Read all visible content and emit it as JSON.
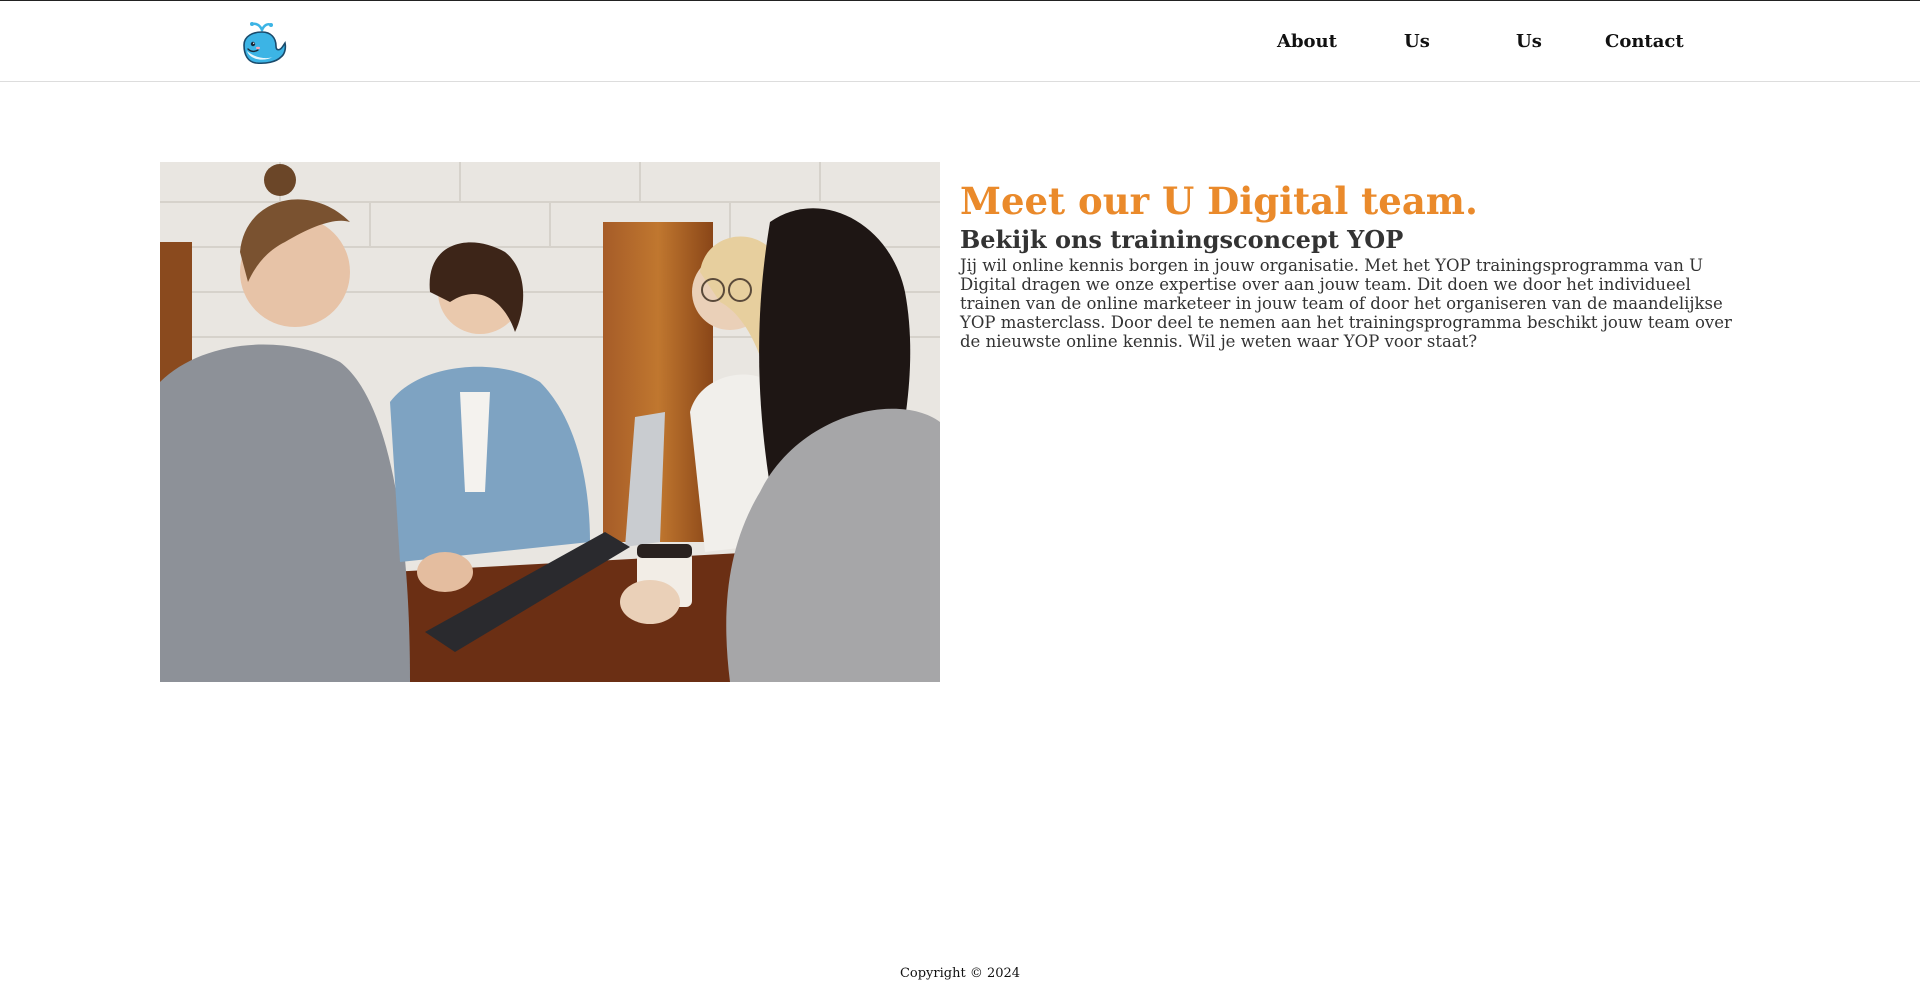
{
  "header": {
    "logo_name": "whale-logo",
    "nav": [
      {
        "label": "About"
      },
      {
        "label": "Us"
      },
      {
        "label": "Us"
      },
      {
        "label": "Contact"
      }
    ]
  },
  "main": {
    "image_name": "team-photo",
    "title": "Meet our U Digital team.",
    "subtitle": "Bekijk ons trainingsconcept YOP",
    "body": "Jij wil online kennis borgen in jouw organisatie. Met het YOP trainingsprogramma van U Digital dragen we onze expertise over aan jouw team. Dit doen we door het individueel trainen van de online marketeer in jouw team of door het organiseren van de maandelijkse YOP masterclass. Door deel te nemen aan het trainingsprogramma beschikt jouw team over de nieuwste online kennis. Wil je weten waar YOP voor staat?"
  },
  "footer": {
    "copyright": "Copyright © 2024"
  },
  "colors": {
    "accent": "#ea8a2b",
    "text": "#333333",
    "logo_blue": "#3cb4e5"
  }
}
